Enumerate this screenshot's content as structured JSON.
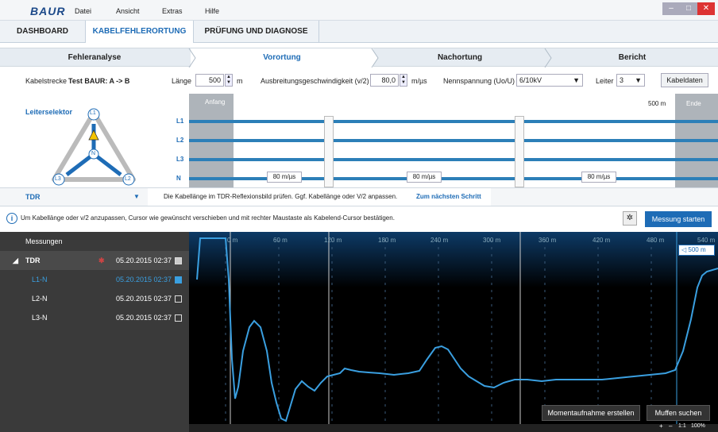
{
  "title_bar": {
    "logo": "BAUR",
    "menu": [
      "Datei",
      "Ansicht",
      "Extras",
      "Hilfe"
    ]
  },
  "main_tabs": [
    {
      "label": "DASHBOARD"
    },
    {
      "label": "KABELFEHLERORTUNG"
    },
    {
      "label": "PRÜFUNG UND DIAGNOSE"
    }
  ],
  "steps": [
    {
      "label": "Fehleranalyse"
    },
    {
      "label": "Vorortung"
    },
    {
      "label": "Nachortung"
    },
    {
      "label": "Bericht"
    }
  ],
  "params": {
    "kabelstrecke_label": "Kabelstrecke",
    "kabelstrecke_value": "Test BAUR: A -> B",
    "laenge_label": "Länge",
    "laenge_value": "500",
    "laenge_unit": "m",
    "v2_label": "Ausbreitungsgeschwindigkeit (v/2)",
    "v2_value": "80,0",
    "v2_unit": "m/µs",
    "spannung_label": "Nennspannung (Uo/U)",
    "spannung_value": "6/10kV",
    "leiter_label": "Leiter",
    "leiter_value": "3",
    "kabeldaten_button": "Kabeldaten"
  },
  "leiterselektor": {
    "title": "Leiterselektor",
    "nodes": [
      "L1",
      "N",
      "L3",
      "L2"
    ]
  },
  "cable": {
    "start_label": "Anfang",
    "length_label": "500 m",
    "end_label": "Ende",
    "lines": [
      "L1",
      "L2",
      "L3",
      "N"
    ],
    "speed_labels": [
      "80 m/µs",
      "80 m/µs",
      "80 m/µs"
    ]
  },
  "tdr_bar": {
    "dropdown": "TDR",
    "hint": "Die Kabellänge im TDR-Reflexionsbild prüfen. Ggf. Kabellänge oder V/2 anpassen.",
    "next_link": "Zum nächsten Schritt"
  },
  "info": {
    "text": "Um Kabellänge oder v/2 anzupassen, Cursor wie gewünscht verschieben und mit rechter Maustaste als Kabelend-Cursor bestätigen.",
    "start_button": "Messung starten"
  },
  "measurements": {
    "header": "Messungen",
    "group": "TDR",
    "group_date": "05.20.2015 02:37",
    "rows": [
      {
        "name": "L1-N",
        "date": "05.20.2015 02:37"
      },
      {
        "name": "L2-N",
        "date": "05.20.2015 02:37"
      },
      {
        "name": "L3-N",
        "date": "05.20.2015 02:37"
      }
    ]
  },
  "plot": {
    "ticks": [
      "0 m",
      "60 m",
      "120 m",
      "180 m",
      "240 m",
      "300 m",
      "360 m",
      "420 m",
      "480 m",
      "540 m"
    ],
    "cursor_label": "500 m",
    "snapshot_button": "Momentaufnahme erstellen",
    "muffen_button": "Muffen suchen",
    "zoom_1to1": "1:1",
    "zoom": "100%"
  },
  "colors": {
    "accent": "#1e6cb6",
    "trace": "#3a9fe0",
    "dark": "#3a3a3a"
  }
}
